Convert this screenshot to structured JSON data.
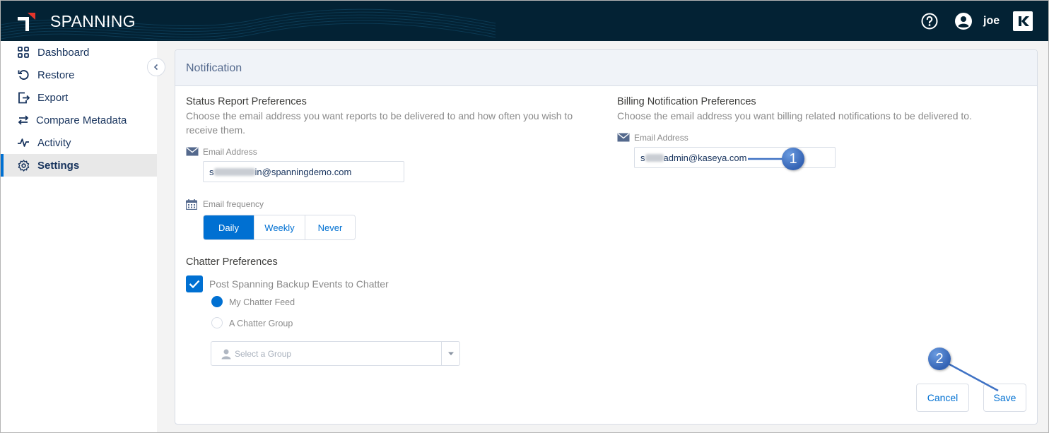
{
  "header": {
    "brand": "SPANNING",
    "username": "joe"
  },
  "sidebar": {
    "items": [
      {
        "label": "Dashboard",
        "icon": "grid-icon"
      },
      {
        "label": "Restore",
        "icon": "restore-icon"
      },
      {
        "label": "Export",
        "icon": "export-icon"
      },
      {
        "label": "Compare Metadata",
        "icon": "compare-arrows-icon"
      },
      {
        "label": "Activity",
        "icon": "pulse-icon"
      },
      {
        "label": "Settings",
        "icon": "gear-icon",
        "active": true
      }
    ]
  },
  "card": {
    "title": "Notification",
    "status": {
      "title": "Status Report Preferences",
      "description": "Choose the email address you want reports to be delivered to and how often you wish to receive them.",
      "email_label": "Email Address",
      "email_prefix": "s",
      "email_value": "in@spanningdemo.com",
      "frequency_label": "Email frequency",
      "frequency_options": [
        "Daily",
        "Weekly",
        "Never"
      ],
      "frequency_selected": "Daily"
    },
    "chatter": {
      "title": "Chatter Preferences",
      "checkbox_label": "Post Spanning Backup Events to Chatter",
      "checked": true,
      "radio_options": [
        "My Chatter Feed",
        "A Chatter Group"
      ],
      "radio_selected": "My Chatter Feed",
      "group_placeholder": "Select a Group"
    },
    "billing": {
      "title": "Billing Notification Preferences",
      "description": "Choose the email address you want billing related notifications to be delivered to.",
      "email_label": "Email Address",
      "email_prefix": "s",
      "email_value": "admin@kaseya.com"
    },
    "buttons": {
      "cancel": "Cancel",
      "save": "Save"
    }
  },
  "annotations": [
    "1",
    "2"
  ],
  "colors": {
    "header_bg": "#032234",
    "accent": "#0070d2",
    "logo_red": "#e5352b",
    "callout": "#3f72c4"
  }
}
